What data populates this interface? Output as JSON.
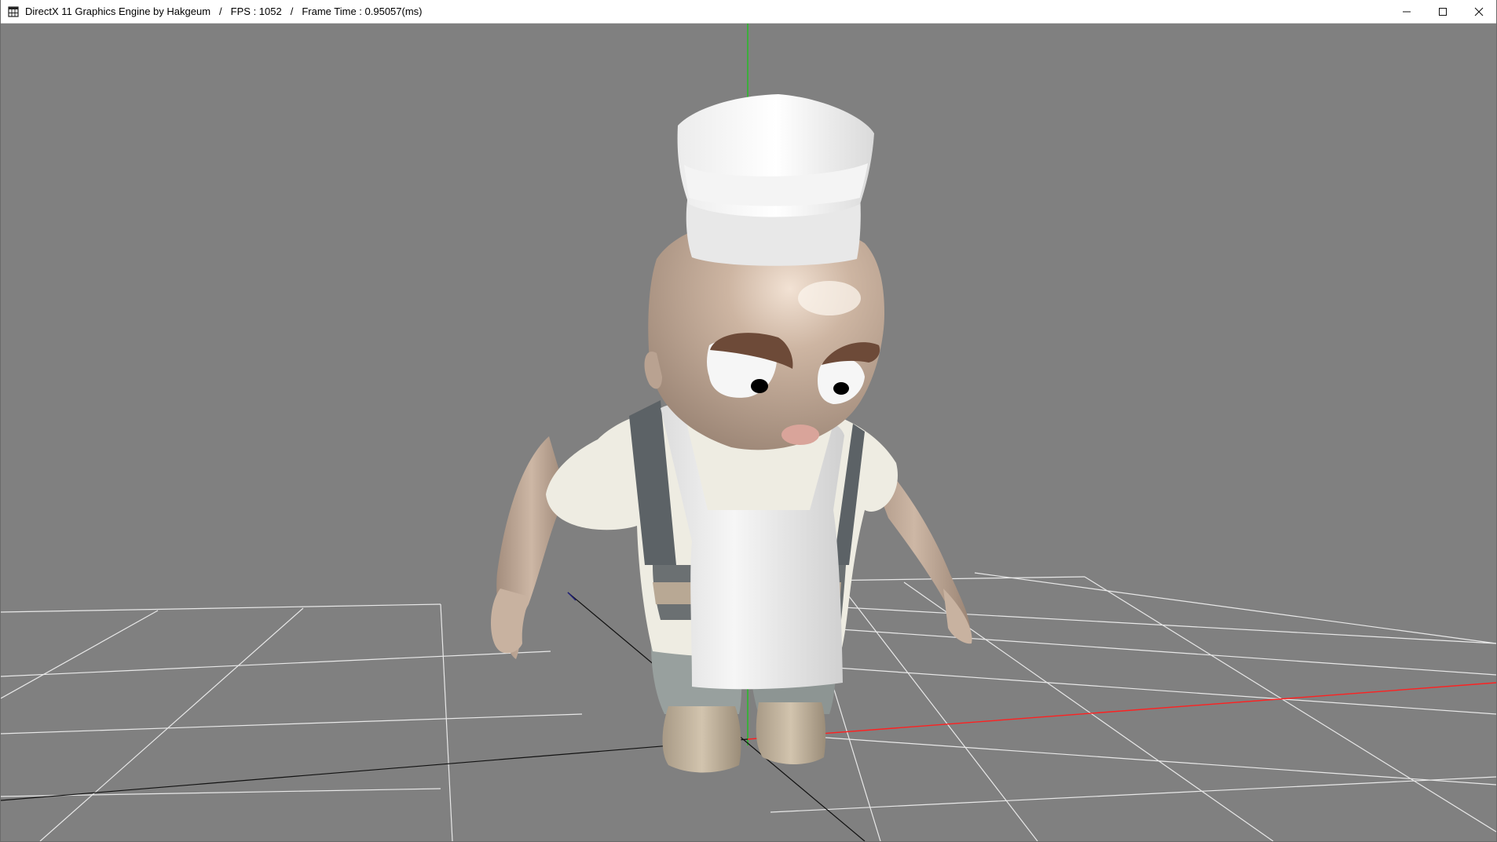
{
  "window": {
    "title_app": "DirectX 11 Graphics Engine by Hakgeum",
    "separator": "/",
    "fps_label": "FPS : 1052",
    "frame_time_label": "Frame Time : 0.95057(ms)",
    "app_icon": "window-app-icon",
    "controls": {
      "minimize_icon": "minimize-icon",
      "maximize_icon": "maximize-icon",
      "close_icon": "close-icon"
    }
  },
  "viewport": {
    "background_color": "#808080",
    "grid_color": "#e6e6e6",
    "axis_x_color": "#ff2020",
    "axis_y_color": "#20c020",
    "axis_z_color": "#202080",
    "model": "chef-character"
  }
}
